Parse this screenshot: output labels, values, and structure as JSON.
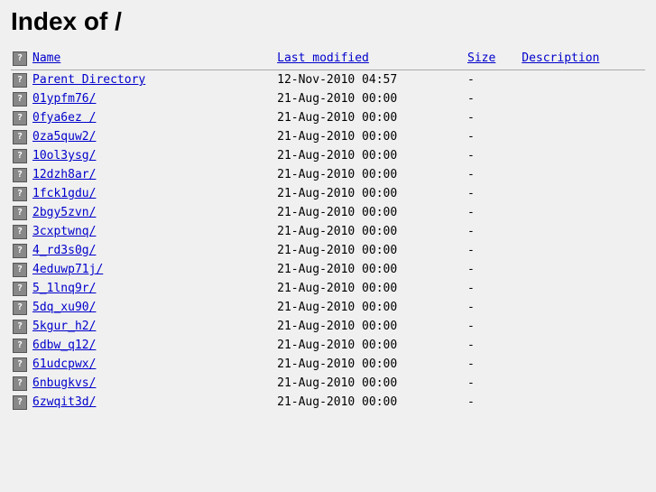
{
  "page": {
    "title": "Index of /",
    "columns": {
      "name": "Name",
      "modified": "Last modified",
      "size": "Size",
      "description": "Description"
    }
  },
  "entries": [
    {
      "name": "Parent Directory",
      "modified": "12-Nov-2010 04:57",
      "size": "-",
      "description": ""
    },
    {
      "name": "01ypfm76/",
      "modified": "21-Aug-2010 00:00",
      "size": "-",
      "description": ""
    },
    {
      "name": "0fya6ez /",
      "modified": "21-Aug-2010 00:00",
      "size": "-",
      "description": ""
    },
    {
      "name": "0za5quw2/",
      "modified": "21-Aug-2010 00:00",
      "size": "-",
      "description": ""
    },
    {
      "name": "10ol3ysg/",
      "modified": "21-Aug-2010 00:00",
      "size": "-",
      "description": ""
    },
    {
      "name": "12dzh8ar/",
      "modified": "21-Aug-2010 00:00",
      "size": "-",
      "description": ""
    },
    {
      "name": "1fck1gdu/",
      "modified": "21-Aug-2010 00:00",
      "size": "-",
      "description": ""
    },
    {
      "name": "2bgy5zvn/",
      "modified": "21-Aug-2010 00:00",
      "size": "-",
      "description": ""
    },
    {
      "name": "3cxptwnq/",
      "modified": "21-Aug-2010 00:00",
      "size": "-",
      "description": ""
    },
    {
      "name": "4_rd3s0g/",
      "modified": "21-Aug-2010 00:00",
      "size": "-",
      "description": ""
    },
    {
      "name": "4eduwp71j/",
      "modified": "21-Aug-2010 00:00",
      "size": "-",
      "description": ""
    },
    {
      "name": "5_1lnq9r/",
      "modified": "21-Aug-2010 00:00",
      "size": "-",
      "description": ""
    },
    {
      "name": "5dq_xu90/",
      "modified": "21-Aug-2010 00:00",
      "size": "-",
      "description": ""
    },
    {
      "name": "5kgur_h2/",
      "modified": "21-Aug-2010 00:00",
      "size": "-",
      "description": ""
    },
    {
      "name": "6dbw_q12/",
      "modified": "21-Aug-2010 00:00",
      "size": "-",
      "description": ""
    },
    {
      "name": "61udcpwx/",
      "modified": "21-Aug-2010 00:00",
      "size": "-",
      "description": ""
    },
    {
      "name": "6nbugkvs/",
      "modified": "21-Aug-2010 00:00",
      "size": "-",
      "description": ""
    },
    {
      "name": "6zwqit3d/",
      "modified": "21-Aug-2010 00:00",
      "size": "-",
      "description": ""
    }
  ]
}
